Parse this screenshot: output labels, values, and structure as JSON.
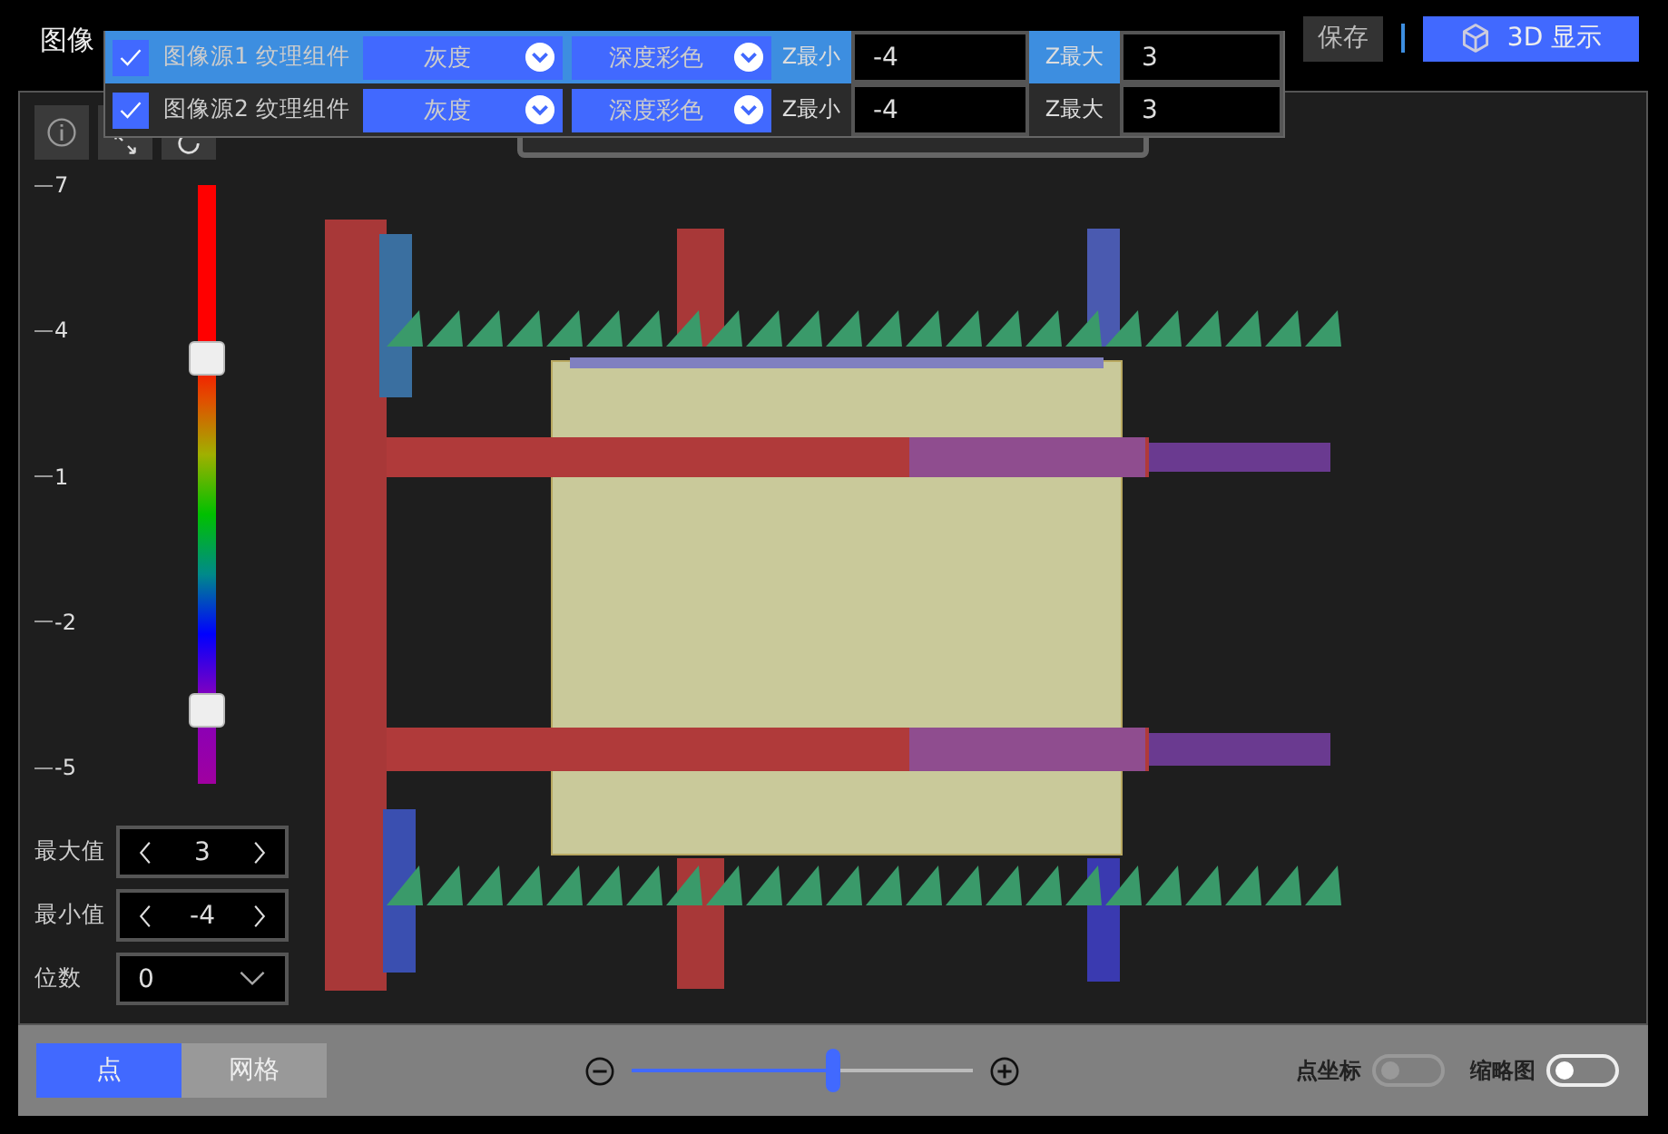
{
  "title": "图像",
  "sources": [
    {
      "label": "图像源1 纹理组件",
      "checked": true,
      "selected": true,
      "texture": "灰度",
      "color_mode": "深度彩色",
      "z_min_label": "Z最小",
      "z_min": "-4",
      "z_max_label": "Z最大",
      "z_max": "3"
    },
    {
      "label": "图像源2 纹理组件",
      "checked": true,
      "selected": false,
      "texture": "灰度",
      "color_mode": "深度彩色",
      "z_min_label": "Z最小",
      "z_min": "-4",
      "z_max_label": "Z最大",
      "z_max": "3"
    }
  ],
  "save_button": "保存",
  "view3d_button": "3D 显示",
  "scale": {
    "ticks": [
      "7",
      "4",
      "1",
      "-2",
      "-5"
    ],
    "thumbs": [
      {
        "level": 0.71
      },
      {
        "level": 0.12
      }
    ]
  },
  "controls": [
    {
      "kind": "spinner",
      "label": "最大值",
      "value": "3"
    },
    {
      "kind": "spinner",
      "label": "最小值",
      "value": "-4"
    },
    {
      "kind": "select",
      "label": "位数",
      "value": "0"
    }
  ],
  "modes": [
    {
      "label": "点",
      "selected": true
    },
    {
      "label": "网格",
      "selected": false
    }
  ],
  "zoom": {
    "level": 0.59
  },
  "toggles": [
    {
      "label": "点坐标",
      "on": false,
      "disabled": true
    },
    {
      "label": "缩略图",
      "on": false,
      "disabled": false
    }
  ]
}
